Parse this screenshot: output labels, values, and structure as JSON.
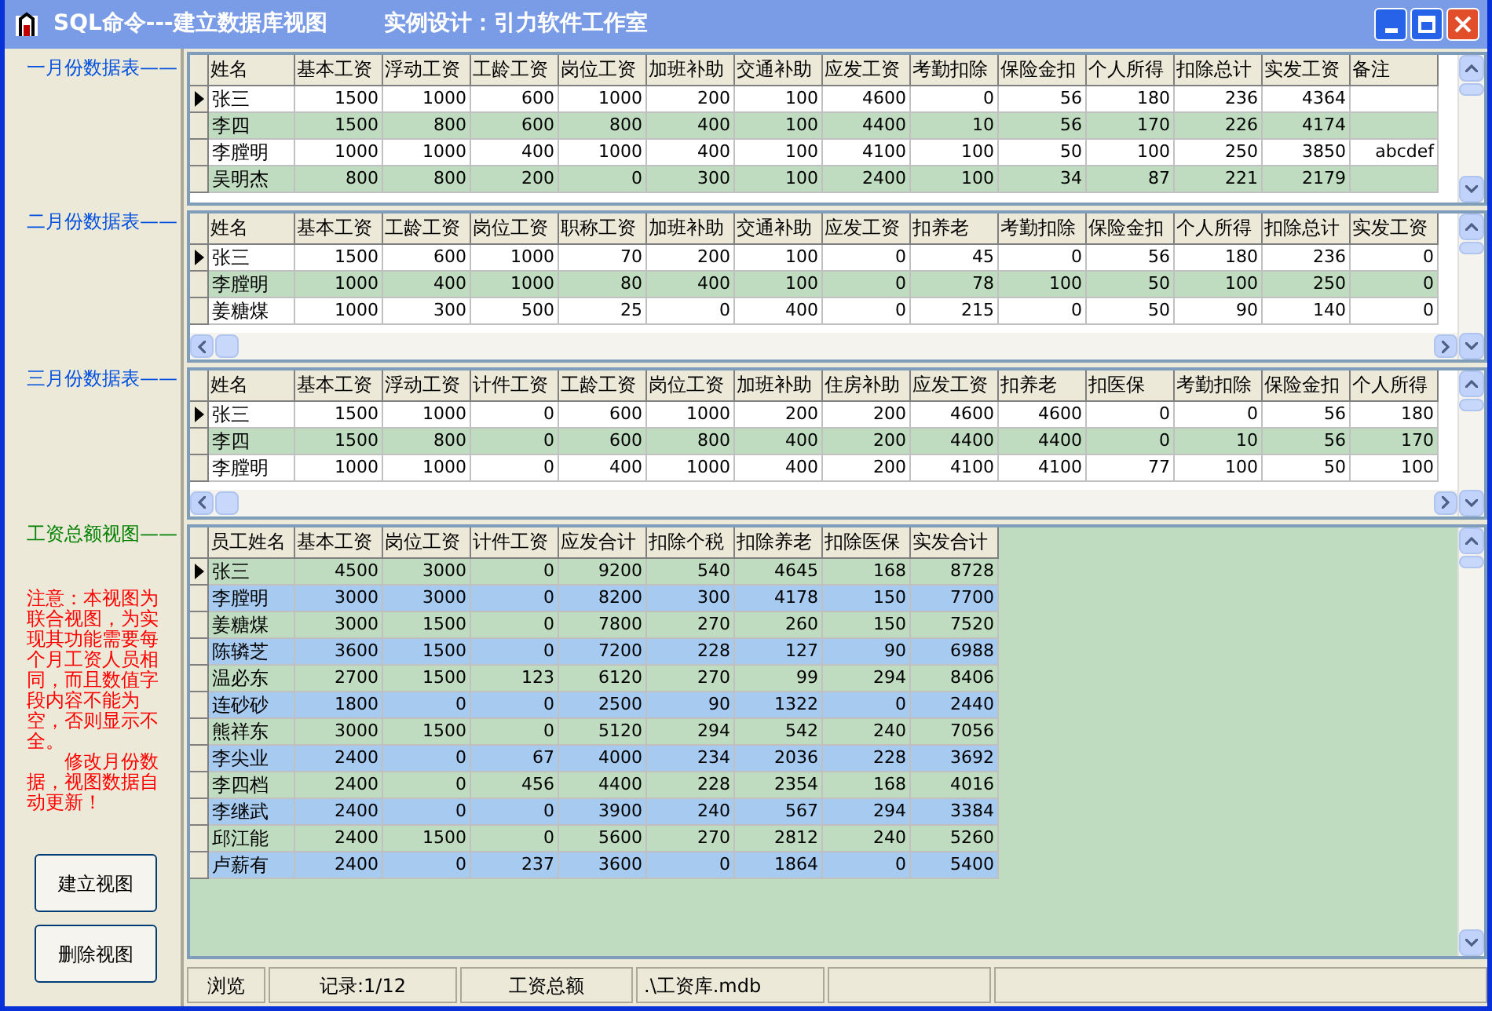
{
  "window": {
    "title": "SQL命令---建立数据库视图",
    "subtitle": "实例设计：引力软件工作室"
  },
  "grids": [
    {
      "label": "一月份数据表——",
      "color": "#0050e0",
      "kind": "table",
      "horizontal_scrollbar": false,
      "columns": [
        "姓名",
        "基本工资",
        "浮动工资",
        "工龄工资",
        "岗位工资",
        "加班补助",
        "交通补助",
        "应发工资",
        "考勤扣除",
        "保险金扣",
        "个人所得",
        "扣除总计",
        "实发工资",
        "备注"
      ],
      "rows": [
        {
          "selected": true,
          "cells": [
            "张三",
            "1500",
            "1000",
            "600",
            "1000",
            "200",
            "100",
            "4600",
            "0",
            "56",
            "180",
            "236",
            "4364",
            ""
          ]
        },
        {
          "selected": false,
          "cells": [
            "李四",
            "1500",
            "800",
            "600",
            "800",
            "400",
            "100",
            "4400",
            "10",
            "56",
            "170",
            "226",
            "4174",
            ""
          ]
        },
        {
          "selected": false,
          "cells": [
            "李膛明",
            "1000",
            "1000",
            "400",
            "1000",
            "400",
            "100",
            "4100",
            "100",
            "50",
            "100",
            "250",
            "3850",
            "abcdef"
          ]
        },
        {
          "selected": false,
          "cells": [
            "吴明杰",
            "800",
            "800",
            "200",
            "0",
            "300",
            "100",
            "2400",
            "100",
            "34",
            "87",
            "221",
            "2179",
            ""
          ]
        }
      ]
    },
    {
      "label": "二月份数据表——",
      "color": "#0050e0",
      "kind": "table",
      "horizontal_scrollbar": true,
      "columns": [
        "姓名",
        "基本工资",
        "工龄工资",
        "岗位工资",
        "职称工资",
        "加班补助",
        "交通补助",
        "应发工资",
        "扣养老",
        "考勤扣除",
        "保险金扣",
        "个人所得",
        "扣除总计",
        "实发工资"
      ],
      "rows": [
        {
          "selected": true,
          "cells": [
            "张三",
            "1500",
            "600",
            "1000",
            "70",
            "200",
            "100",
            "0",
            "45",
            "0",
            "56",
            "180",
            "236",
            "0"
          ]
        },
        {
          "selected": false,
          "cells": [
            "李膛明",
            "1000",
            "400",
            "1000",
            "80",
            "400",
            "100",
            "0",
            "78",
            "100",
            "50",
            "100",
            "250",
            "0"
          ]
        },
        {
          "selected": false,
          "cells": [
            "姜糖煤",
            "1000",
            "300",
            "500",
            "25",
            "0",
            "400",
            "0",
            "215",
            "0",
            "50",
            "90",
            "140",
            "0"
          ]
        }
      ]
    },
    {
      "label": "三月份数据表——",
      "color": "#0050e0",
      "kind": "table",
      "horizontal_scrollbar": true,
      "columns": [
        "姓名",
        "基本工资",
        "浮动工资",
        "计件工资",
        "工龄工资",
        "岗位工资",
        "加班补助",
        "住房补助",
        "应发工资",
        "扣养老",
        "扣医保",
        "考勤扣除",
        "保险金扣",
        "个人所得"
      ],
      "rows": [
        {
          "selected": true,
          "cells": [
            "张三",
            "1500",
            "1000",
            "0",
            "600",
            "1000",
            "200",
            "200",
            "4600",
            "4600",
            "0",
            "0",
            "56",
            "180"
          ]
        },
        {
          "selected": false,
          "cells": [
            "李四",
            "1500",
            "800",
            "0",
            "600",
            "800",
            "400",
            "200",
            "4400",
            "4400",
            "0",
            "10",
            "56",
            "170"
          ]
        },
        {
          "selected": false,
          "cells": [
            "李膛明",
            "1000",
            "1000",
            "0",
            "400",
            "1000",
            "400",
            "200",
            "4100",
            "4100",
            "77",
            "100",
            "50",
            "100"
          ]
        }
      ]
    },
    {
      "label": "工资总额视图——",
      "color": "#008000",
      "kind": "view",
      "horizontal_scrollbar": false,
      "columns": [
        "员工姓名",
        "基本工资",
        "岗位工资",
        "计件工资",
        "应发合计",
        "扣除个税",
        "扣除养老",
        "扣除医保",
        "实发合计"
      ],
      "rows": [
        {
          "selected": true,
          "cells": [
            "张三",
            "4500",
            "3000",
            "0",
            "9200",
            "540",
            "4645",
            "168",
            "8728"
          ]
        },
        {
          "selected": false,
          "cells": [
            "李膛明",
            "3000",
            "3000",
            "0",
            "8200",
            "300",
            "4178",
            "150",
            "7700"
          ]
        },
        {
          "selected": false,
          "cells": [
            "姜糖煤",
            "3000",
            "1500",
            "0",
            "7800",
            "270",
            "260",
            "150",
            "7520"
          ]
        },
        {
          "selected": false,
          "cells": [
            "陈辚芝",
            "3600",
            "1500",
            "0",
            "7200",
            "228",
            "127",
            "90",
            "6988"
          ]
        },
        {
          "selected": false,
          "cells": [
            "温必东",
            "2700",
            "1500",
            "123",
            "6120",
            "270",
            "99",
            "294",
            "8406"
          ]
        },
        {
          "selected": false,
          "cells": [
            "连砂砂",
            "1800",
            "0",
            "0",
            "2500",
            "90",
            "1322",
            "0",
            "2440"
          ]
        },
        {
          "selected": false,
          "cells": [
            "熊祥东",
            "3000",
            "1500",
            "0",
            "5120",
            "294",
            "542",
            "240",
            "7056"
          ]
        },
        {
          "selected": false,
          "cells": [
            "李尖业",
            "2400",
            "0",
            "67",
            "4000",
            "234",
            "2036",
            "228",
            "3692"
          ]
        },
        {
          "selected": false,
          "cells": [
            "李四档",
            "2400",
            "0",
            "456",
            "4400",
            "228",
            "2354",
            "168",
            "4016"
          ]
        },
        {
          "selected": false,
          "cells": [
            "李继武",
            "2400",
            "0",
            "0",
            "3900",
            "240",
            "567",
            "294",
            "3384"
          ]
        },
        {
          "selected": false,
          "cells": [
            "邱江能",
            "2400",
            "1500",
            "0",
            "5600",
            "270",
            "2812",
            "240",
            "5260"
          ]
        },
        {
          "selected": false,
          "cells": [
            "卢薪有",
            "2400",
            "0",
            "237",
            "3600",
            "0",
            "1864",
            "0",
            "5400"
          ]
        }
      ]
    }
  ],
  "note": "注意：本视图为联合视图，为实现其功能需要每个月工资人员相同，而且数值字段内容不能为空，否则显示不全。",
  "note_2": "修改月份数据，视图数据自动更新！",
  "buttons": [
    "建立视图",
    "删除视图"
  ],
  "status_bar": [
    "浏览",
    "记录:1/12",
    "工资总额",
    ".\\工资库.mdb"
  ]
}
